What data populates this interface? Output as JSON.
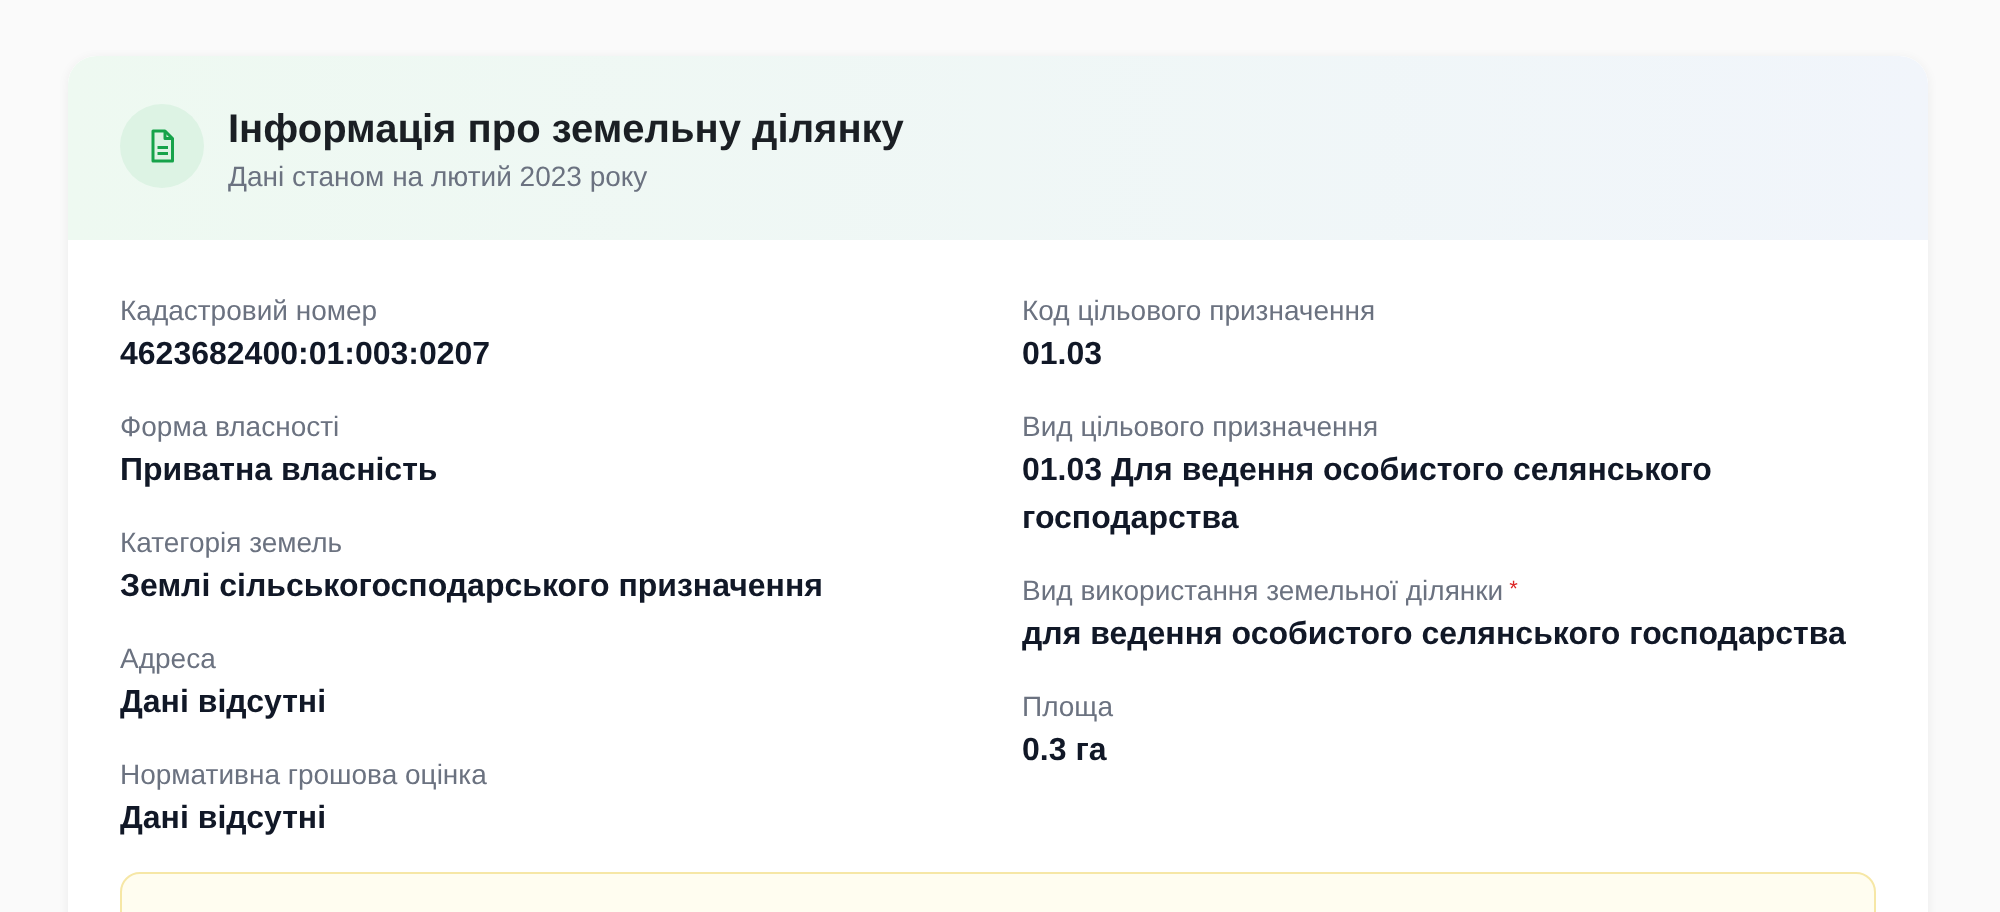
{
  "card": {
    "title": "Інформація про земельну ділянку",
    "subtitle": "Дані станом на лютий 2023 року",
    "left_fields": [
      {
        "label": "Кадастровий номер",
        "value": "4623682400:01:003:0207"
      },
      {
        "label": "Форма власності",
        "value": "Приватна власність"
      },
      {
        "label": "Категорія земель",
        "value": "Землі сільськогосподарського призначення"
      },
      {
        "label": "Адреса",
        "value": "Дані відсутні"
      },
      {
        "label": "Нормативна грошова оцінка",
        "value": "Дані відсутні"
      }
    ],
    "right_fields": [
      {
        "label": "Код цільового призначення",
        "value": "01.03"
      },
      {
        "label": "Вид цільового призначення",
        "value": "01.03 Для ведення особистого селянського господарства"
      },
      {
        "label": "Вид використання земельної ділянки",
        "required_mark": "*",
        "value": "для ведення особистого селянського господарства"
      },
      {
        "label": "Площа",
        "value": "0.3 га"
      }
    ]
  }
}
